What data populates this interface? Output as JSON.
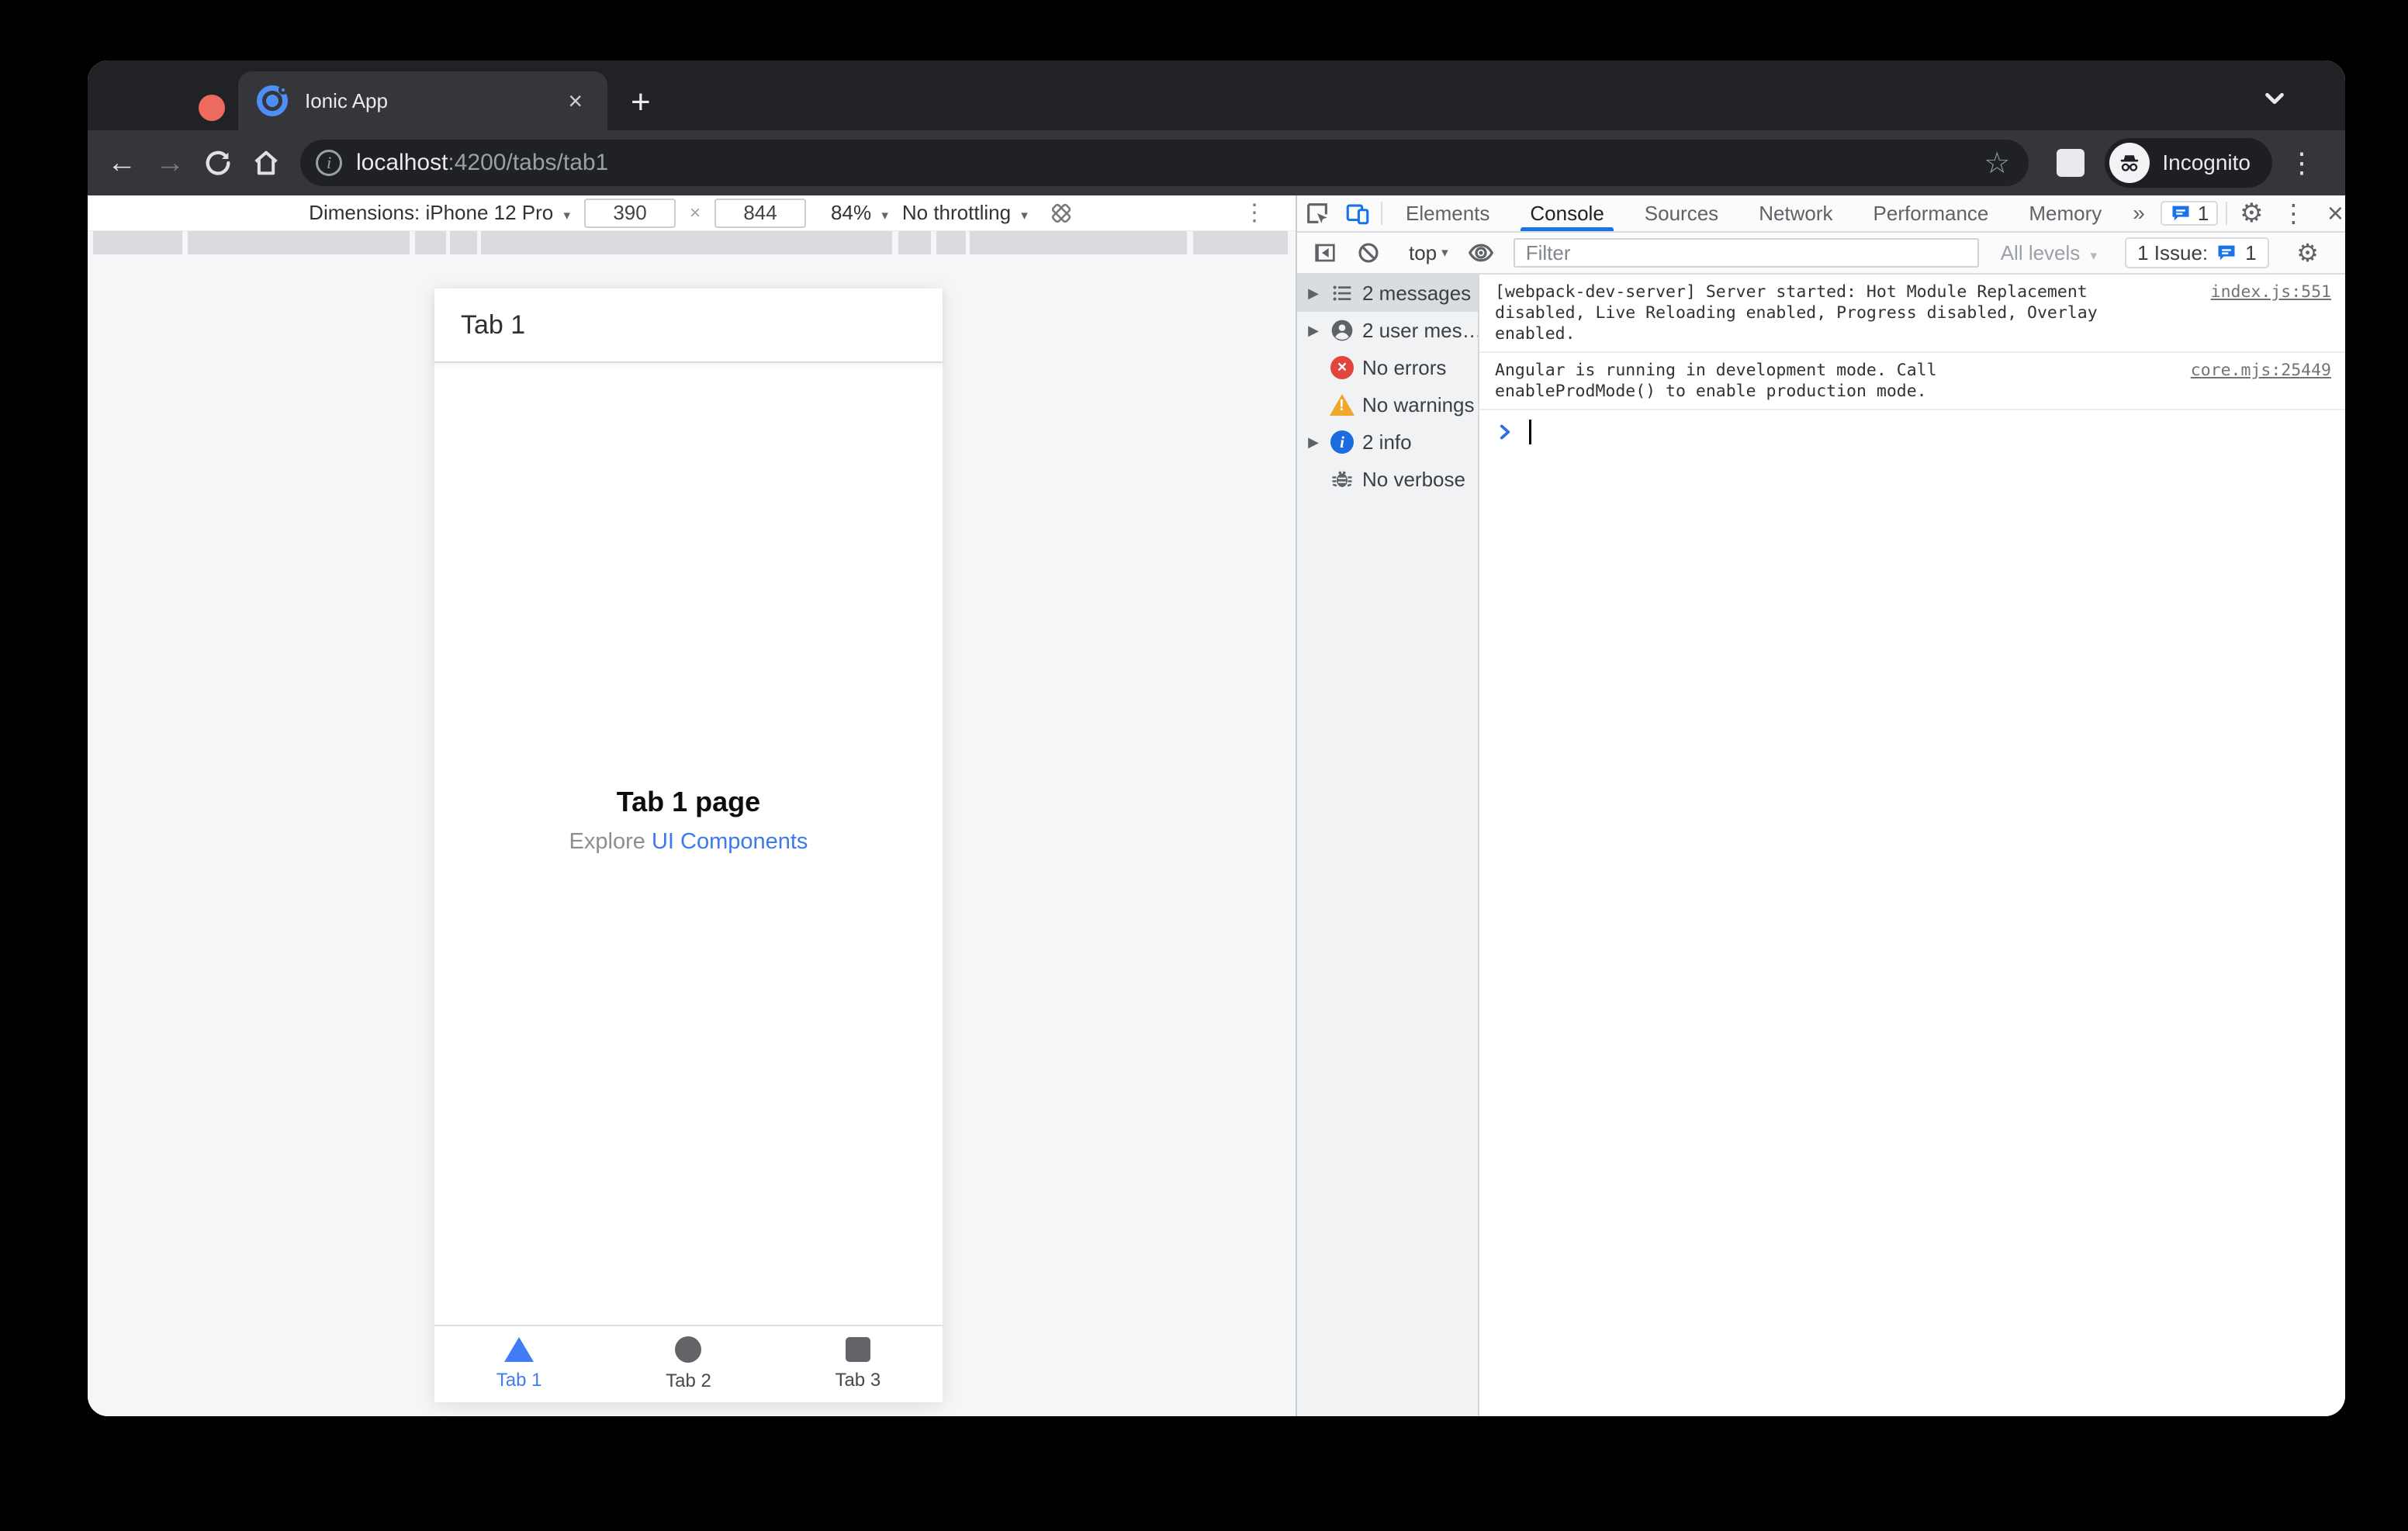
{
  "glyphs": {
    "chevron_down": "▾",
    "back": "←",
    "forward": "→",
    "plus": "+",
    "close": "×",
    "star": "☆",
    "dots_v": "⋮",
    "gear": "⚙",
    "more_tabs": "»",
    "triangle_right": "▶"
  },
  "browser": {
    "tab_title": "Ionic App",
    "url_host": "localhost",
    "url_rest": ":4200/tabs/tab1",
    "incognito_label": "Incognito"
  },
  "device_toolbar": {
    "dimensions_label": "Dimensions: iPhone 12 Pro",
    "width_value": "390",
    "times": "×",
    "height_value": "844",
    "zoom_value": "84%",
    "throttling": "No throttling"
  },
  "phone": {
    "header_title": "Tab 1",
    "hero_title": "Tab 1 page",
    "hero_prefix": "Explore ",
    "hero_link": "UI Components",
    "tabs": [
      {
        "label": "Tab 1"
      },
      {
        "label": "Tab 2"
      },
      {
        "label": "Tab 3"
      }
    ]
  },
  "devtools": {
    "tabs": [
      {
        "label": "Elements"
      },
      {
        "label": "Console"
      },
      {
        "label": "Sources"
      },
      {
        "label": "Network"
      },
      {
        "label": "Performance"
      },
      {
        "label": "Memory"
      }
    ],
    "issues_tab_count": "1",
    "toolbar": {
      "context": "top",
      "filter_placeholder": "Filter",
      "levels": "All levels",
      "issue_label": "1 Issue:",
      "issue_count": "1"
    },
    "sidebar": {
      "items": [
        {
          "label": "2 messages"
        },
        {
          "label": "2 user mes…"
        },
        {
          "label": "No errors"
        },
        {
          "label": "No warnings"
        },
        {
          "label": "2 info"
        },
        {
          "label": "No verbose"
        }
      ]
    },
    "console": {
      "messages": [
        {
          "line1": "[webpack-dev-server] Server started: Hot Module Replacement",
          "line2": "disabled, Live Reloading enabled, Progress disabled, Overlay enabled.",
          "source": "index.js:551"
        },
        {
          "line1": "Angular is running in development mode. Call",
          "line2": "enableProdMode() to enable production mode.",
          "source": "core.mjs:25449"
        }
      ]
    }
  }
}
